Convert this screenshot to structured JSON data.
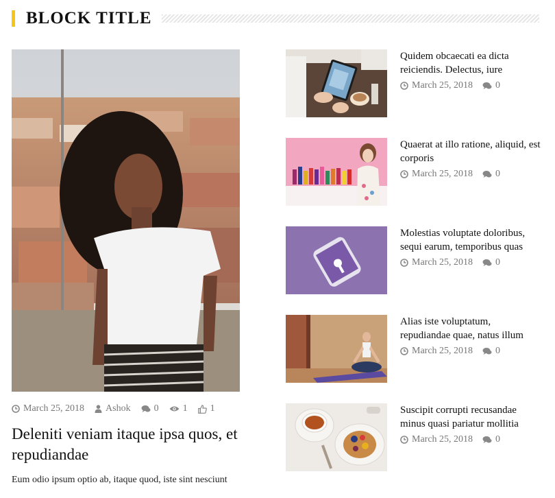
{
  "block": {
    "title": "BLOCK TITLE"
  },
  "main_post": {
    "date": "March 25, 2018",
    "author": "Ashok",
    "comments": "0",
    "views": "1",
    "likes": "1",
    "title": "Deleniti veniam itaque ipsa quos, et repudiandae",
    "excerpt": "Eum odio ipsum optio ab, itaque quod, iste sint nesciunt"
  },
  "side_posts": [
    {
      "title": "Quidem obcaecati ea dicta reiciendis. Delectus, iure",
      "date": "March 25, 2018",
      "comments": "0"
    },
    {
      "title": "Quaerat at illo ratione, aliquid, est corporis",
      "date": "March 25, 2018",
      "comments": "0"
    },
    {
      "title": "Molestias voluptate doloribus, sequi earum, temporibus quas",
      "date": "March 25, 2018",
      "comments": "0"
    },
    {
      "title": "Alias iste voluptatum, repudiandae quae, natus illum",
      "date": "March 25, 2018",
      "comments": "0"
    },
    {
      "title": "Suscipit corrupti recusandae minus quasi pariatur mollitia",
      "date": "March 25, 2018",
      "comments": "0"
    }
  ],
  "icons": {
    "clock": "clock-icon",
    "user": "user-icon",
    "comment": "comment-icon",
    "eye": "eye-icon",
    "like": "thumbs-up-icon"
  },
  "colors": {
    "accent": "#f5c518",
    "meta_text": "#777777",
    "title_text": "#111111"
  }
}
